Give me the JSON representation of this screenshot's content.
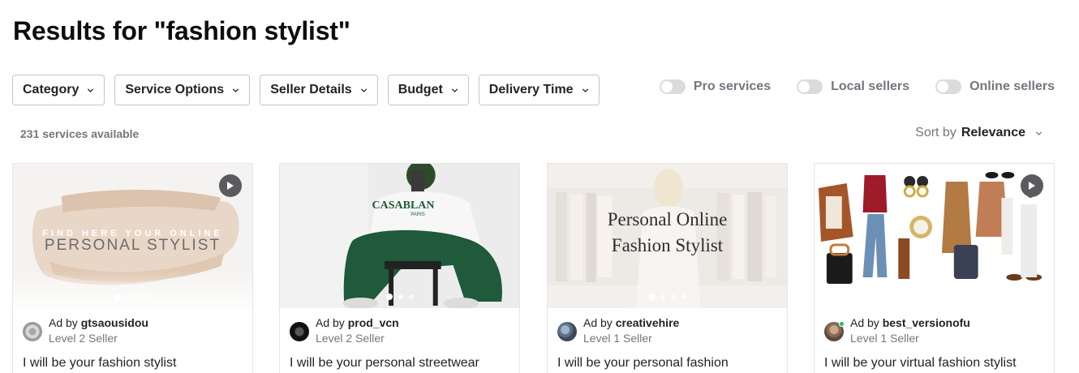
{
  "page": {
    "title": "Results for \"fashion stylist\""
  },
  "filters": [
    {
      "label": "Category",
      "icon": "chevron-down-icon"
    },
    {
      "label": "Service Options",
      "icon": "chevron-down-icon"
    },
    {
      "label": "Seller Details",
      "icon": "chevron-down-icon"
    },
    {
      "label": "Budget",
      "icon": "chevron-down-icon"
    },
    {
      "label": "Delivery Time",
      "icon": "chevron-down-icon"
    }
  ],
  "toggles": [
    {
      "label": "Pro services",
      "on": false
    },
    {
      "label": "Local sellers",
      "on": false
    },
    {
      "label": "Online sellers",
      "on": false
    }
  ],
  "results": {
    "count_text": "231 services available",
    "sort_prefix": "Sort by",
    "sort_value": "Relevance"
  },
  "cards": [
    {
      "thumb_text_small": "FIND HERE YOUR ONLINE",
      "thumb_text_large": "PERSONAL STYLIST",
      "has_play": true,
      "dots": 4,
      "active_dot": 0,
      "ad_prefix": "Ad by",
      "seller": "gtsaousidou",
      "level": "Level 2 Seller",
      "title": "I will be your fashion stylist"
    },
    {
      "thumb_text_small": "CASABLAN",
      "thumb_text_large": "PARIS",
      "has_play": false,
      "dots": 3,
      "active_dot": 0,
      "ad_prefix": "Ad by",
      "seller": "prod_vcn",
      "level": "Level 2 Seller",
      "title": "I will be your personal streetwear"
    },
    {
      "thumb_text_small": "Personal Online",
      "thumb_text_large": "Fashion Stylist",
      "has_play": false,
      "dots": 4,
      "active_dot": 0,
      "ad_prefix": "Ad by",
      "seller": "creativehire",
      "level": "Level 1 Seller",
      "title": "I will be your personal fashion"
    },
    {
      "has_play": true,
      "dots": 4,
      "active_dot": 0,
      "ad_prefix": "Ad by",
      "seller": "best_versionofu",
      "level": "Level 1 Seller",
      "title": "I will be your virtual fashion stylist",
      "online": true
    }
  ],
  "colors": {
    "accent_online": "#1dbf73",
    "muted_text": "#74767e",
    "border": "#c5c6c9"
  }
}
